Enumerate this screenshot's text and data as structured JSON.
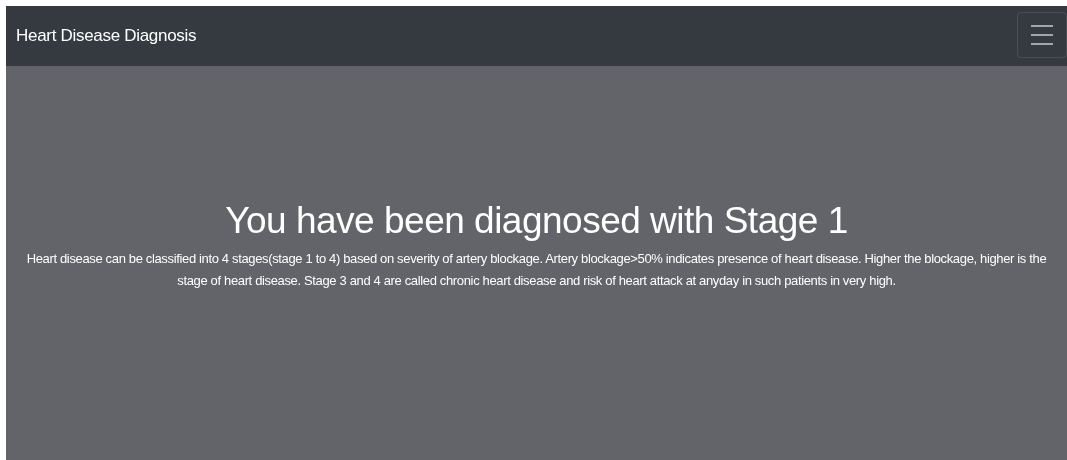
{
  "navbar": {
    "brand": "Heart Disease Diagnosis",
    "menu_button": {
      "expanded": false
    }
  },
  "result": {
    "heading": "You have been diagnosed with Stage 1",
    "description": "Heart disease can be classified into 4 stages(stage 1 to 4) based on severity of artery blockage. Artery blockage>50% indicates presence of heart disease. Higher the blockage, higher is the stage of heart disease. Stage 3 and 4 are called chronic heart disease and risk of heart attack at anyday in such patients in very high."
  }
}
